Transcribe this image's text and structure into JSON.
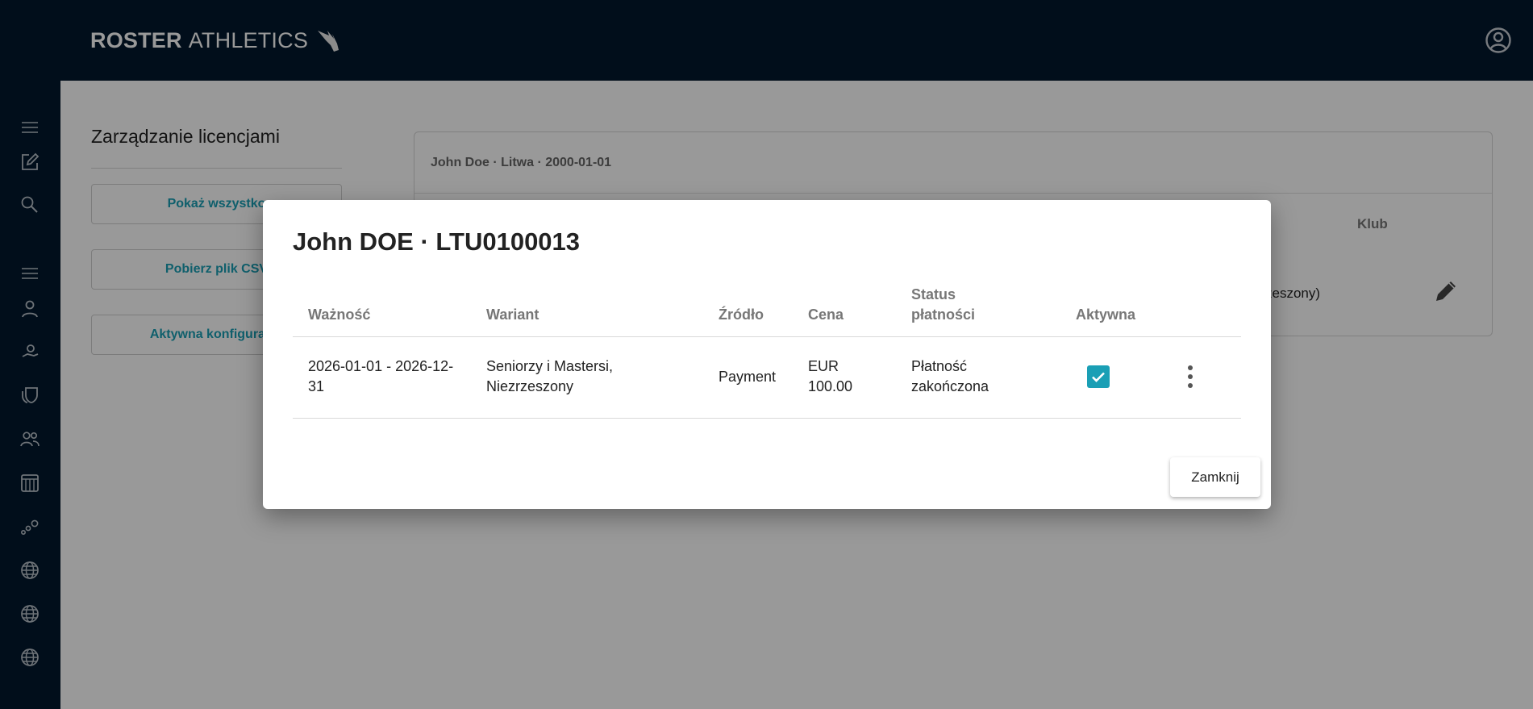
{
  "brand": {
    "bold": "ROSTER",
    "light": "ATHLETICS"
  },
  "icons": {
    "account": "account-circle-icon",
    "sidebar": [
      "menu-icon",
      "edit-icon",
      "search-icon",
      "menu-icon",
      "person-icon",
      "athlete-icon",
      "shield-icon",
      "group-icon",
      "calendar-icon",
      "relay-icon",
      "globe-icon",
      "globe-icon",
      "globe-icon"
    ]
  },
  "colors": {
    "topbar": "#03182d",
    "accent": "#1a9fb5"
  },
  "panel": {
    "title": "Zarządzanie licencjami",
    "buttons": [
      "Pokaż wszystko",
      "Pobierz plik CSV",
      "Aktywna konfiguracja"
    ]
  },
  "card": {
    "header": "John Doe · Litwa · 2000-01-01",
    "column_club": "Klub",
    "row_variant_partial": "zeszony)"
  },
  "modal": {
    "title": "John DOE · LTU0100013",
    "columns": [
      "Ważność",
      "Wariant",
      "Źródło",
      "Cena",
      "Status płatności",
      "Aktywna"
    ],
    "column_status_lines": [
      "Status",
      "płatności"
    ],
    "row": {
      "validity_lines": [
        "2026-01-01 - 2026-12-",
        "31"
      ],
      "variant_lines": [
        "Seniorzy i Mastersi,",
        "Niezrzeszony"
      ],
      "source": "Payment",
      "price_lines": [
        "EUR",
        "100.00"
      ],
      "status_lines": [
        "Płatność",
        "zakończona"
      ],
      "active": true
    },
    "close_label": "Zamknij"
  }
}
